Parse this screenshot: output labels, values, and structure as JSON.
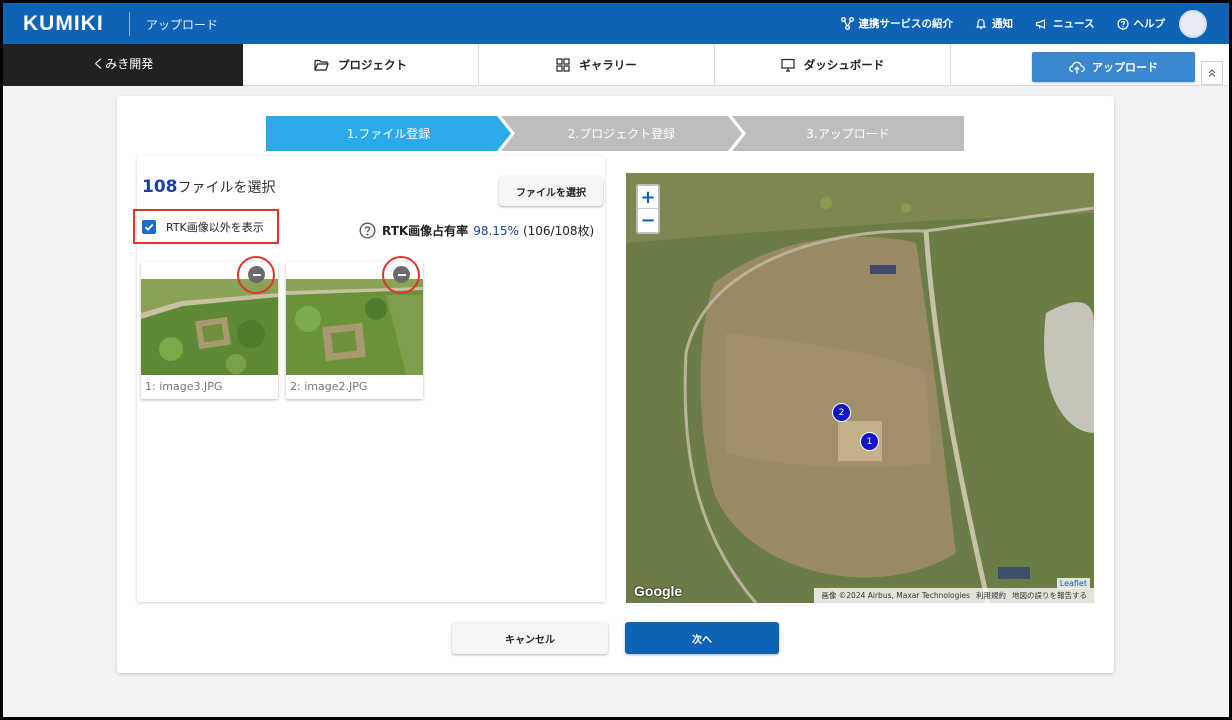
{
  "header": {
    "logo": "KUMIKI",
    "app_title": "アップロード",
    "links": {
      "services": "連携サービスの紹介",
      "notifications": "通知",
      "news": "ニュース",
      "help": "ヘルプ"
    }
  },
  "nav": {
    "brand": "くみき開発",
    "tabs": {
      "project": "プロジェクト",
      "gallery": "ギャラリー",
      "dashboard": "ダッシュボード"
    },
    "upload_button": "アップロード"
  },
  "steps": [
    "1.ファイル登録",
    "2.プロジェクト登録",
    "3.アップロード"
  ],
  "file_panel": {
    "count": "108",
    "count_suffix": "ファイルを選択",
    "select_button": "ファイルを選択",
    "rtk_checkbox_label": "RTK画像以外を表示",
    "rtk_checkbox_checked": true,
    "rtk_rate_label": "RTK画像占有率",
    "rtk_rate_percent": "98.15%",
    "rtk_rate_fraction": "(106/108枚)",
    "thumbnails": [
      {
        "caption": "1: image3.JPG"
      },
      {
        "caption": "2: image2.JPG"
      }
    ]
  },
  "map": {
    "zoom_in": "+",
    "zoom_out": "−",
    "markers": [
      "1",
      "2"
    ],
    "google_logo": "Google",
    "attribution": [
      "画像 ©2024 Airbus, Maxar Technologies",
      "利用規約",
      "地図の誤りを報告する"
    ],
    "leaflet": "Leaflet"
  },
  "actions": {
    "cancel": "キャンセル",
    "next": "次へ"
  },
  "colors": {
    "header_bg": "#0e63b7",
    "active_step": "#2aaae9",
    "inactive_step": "#bdbdbd",
    "highlight_red": "#e0332a"
  }
}
